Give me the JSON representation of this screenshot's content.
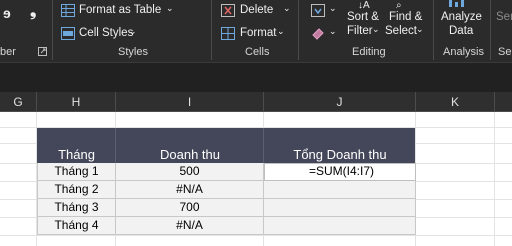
{
  "ribbon": {
    "partial_left_top": "ɘ",
    "format_as_table": "Format as Table",
    "cell_styles": "Cell Styles",
    "styles_group": "Styles",
    "delete": "Delete",
    "format": "Format",
    "cells_group": "Cells",
    "sort_filter_line1": "Sort &",
    "sort_filter_line2": "Filter",
    "find_select_line1": "Find &",
    "find_select_line2": "Select",
    "editing_group": "Editing",
    "analyze_line1": "Analyze",
    "analyze_line2": "Data",
    "analysis_group": "Analysis",
    "partial_left_group": "ber",
    "partial_right_top": "Sen",
    "partial_right_group": "Se"
  },
  "columns": [
    "G",
    "H",
    "I",
    "J",
    "K"
  ],
  "table": {
    "headers": [
      "Tháng",
      "Doanh thu",
      "Tổng Doanh thu"
    ],
    "rows": [
      {
        "month": "Tháng 1",
        "revenue": "500",
        "total": "=SUM(I4:I7)"
      },
      {
        "month": "Tháng 2",
        "revenue": "#N/A",
        "total": ""
      },
      {
        "month": "Tháng 3",
        "revenue": "700",
        "total": ""
      },
      {
        "month": "Tháng 4",
        "revenue": "#N/A",
        "total": ""
      }
    ]
  },
  "colors": {
    "ribbon_bg": "#2b2b2b",
    "table_header_bg": "#44475a",
    "table_body_bg": "#f2f2f2"
  }
}
